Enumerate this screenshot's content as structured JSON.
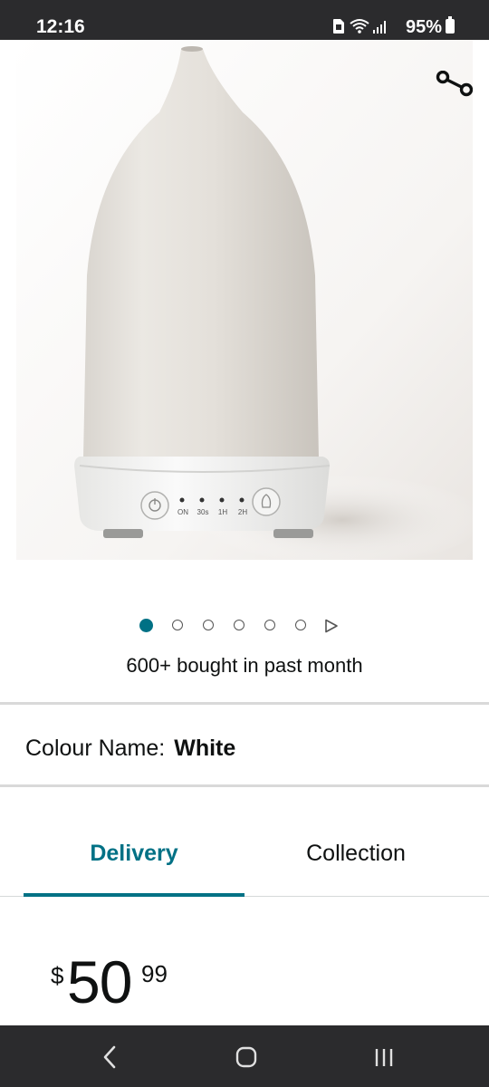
{
  "status_bar": {
    "time": "12:16",
    "battery": "95%",
    "icons": [
      "sim-icon",
      "wifi-icon",
      "signal-icon",
      "battery-icon"
    ]
  },
  "product": {
    "image_alt": "White ceramic stone diffuser",
    "device_labels": [
      "ON",
      "30s",
      "1H",
      "2H"
    ],
    "share_icon": "share-icon"
  },
  "carousel": {
    "count": 6,
    "active_index": 0,
    "next_icon": "play-triangle-icon"
  },
  "bought_text": "600+ bought in past month",
  "colour": {
    "label": "Colour Name:",
    "value": "White"
  },
  "tabs": [
    {
      "label": "Delivery",
      "active": true
    },
    {
      "label": "Collection",
      "active": false
    }
  ],
  "price": {
    "symbol": "$",
    "whole": "50",
    "fraction": "99"
  },
  "nav_bar": {
    "icons": [
      "back-icon",
      "home-icon",
      "recents-icon"
    ]
  },
  "colors": {
    "accent": "#007185",
    "system_bar": "#2b2b2d",
    "text": "#0f1111"
  }
}
